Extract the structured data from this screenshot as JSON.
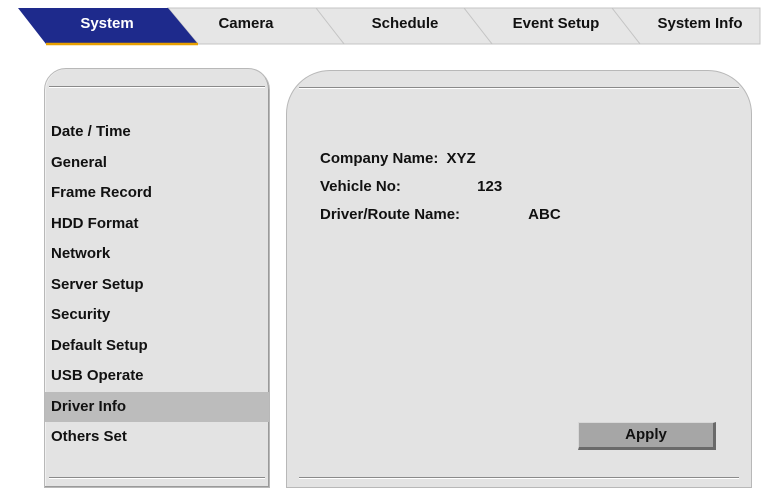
{
  "tabs": [
    {
      "label": "System",
      "active": true
    },
    {
      "label": "Camera",
      "active": false
    },
    {
      "label": "Schedule",
      "active": false
    },
    {
      "label": "Event Setup",
      "active": false
    },
    {
      "label": "System Info",
      "active": false
    }
  ],
  "menu": {
    "items": [
      {
        "label": "Date / Time",
        "selected": false
      },
      {
        "label": "General",
        "selected": false
      },
      {
        "label": "Frame Record",
        "selected": false
      },
      {
        "label": "HDD Format",
        "selected": false
      },
      {
        "label": "Network",
        "selected": false
      },
      {
        "label": "Server Setup",
        "selected": false
      },
      {
        "label": "Security",
        "selected": false
      },
      {
        "label": "Default Setup",
        "selected": false
      },
      {
        "label": "USB Operate",
        "selected": false
      },
      {
        "label": "Driver Info",
        "selected": true
      },
      {
        "label": "Others Set",
        "selected": false
      }
    ]
  },
  "driver_info": {
    "company_label": "Company Name:",
    "company_value": "XYZ",
    "vehicle_label": "Vehicle No:",
    "vehicle_value": "123",
    "driver_label": "Driver/Route Name:",
    "driver_value": "ABC"
  },
  "apply_label": "Apply",
  "colors": {
    "active_tab": "#1e2a8c",
    "active_tab_underline": "#e8a000",
    "panel_bg": "#e3e3e3",
    "selected_item_bg": "#bcbcbc",
    "button_bg": "#a6a6a6"
  }
}
